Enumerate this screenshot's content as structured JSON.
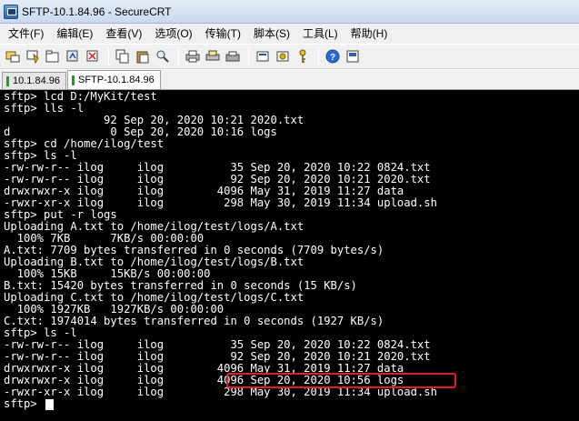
{
  "window": {
    "title": "SFTP-10.1.84.96 - SecureCRT"
  },
  "menu": {
    "items": [
      "文件(F)",
      "编辑(E)",
      "查看(V)",
      "选项(O)",
      "传输(T)",
      "脚本(S)",
      "工具(L)",
      "帮助(H)"
    ]
  },
  "toolbar": {
    "icons": [
      "connect-icon",
      "quick-connect-icon",
      "connect-tab-icon",
      "reconnect-icon",
      "disconnect-icon",
      "copy-icon",
      "paste-icon",
      "find-icon",
      "print-icon",
      "print-selection-icon",
      "print-setup-icon",
      "session-options-icon",
      "global-options-icon",
      "key-icon",
      "help-icon",
      "about-icon"
    ]
  },
  "tabs": [
    {
      "label": "10.1.84.96",
      "active": false
    },
    {
      "label": "SFTP-10.1.84.96",
      "active": true
    }
  ],
  "terminal": {
    "lines": [
      "sftp> lcd D:/MyKit/test",
      "sftp> lls -l",
      "               92 Sep 20, 2020 10:21 2020.txt",
      "d               0 Sep 20, 2020 10:16 logs",
      "sftp> cd /home/ilog/test",
      "sftp> ls -l",
      "-rw-rw-r-- ilog     ilog          35 Sep 20, 2020 10:22 0824.txt",
      "-rw-rw-r-- ilog     ilog          92 Sep 20, 2020 10:21 2020.txt",
      "drwxrwxr-x ilog     ilog        4096 May 31, 2019 11:27 data",
      "-rwxr-xr-x ilog     ilog         298 May 30, 2019 11:34 upload.sh",
      "sftp> put -r logs",
      "Uploading A.txt to /home/ilog/test/logs/A.txt",
      "  100% 7KB      7KB/s 00:00:00",
      "A.txt: 7709 bytes transferred in 0 seconds (7709 bytes/s)",
      "Uploading B.txt to /home/ilog/test/logs/B.txt",
      "  100% 15KB     15KB/s 00:00:00",
      "B.txt: 15420 bytes transferred in 0 seconds (15 KB/s)",
      "Uploading C.txt to /home/ilog/test/logs/C.txt",
      "  100% 1927KB   1927KB/s 00:00:00",
      "C.txt: 1974014 bytes transferred in 0 seconds (1927 KB/s)",
      "sftp> ls -l",
      "-rw-rw-r-- ilog     ilog          35 Sep 20, 2020 10:22 0824.txt",
      "-rw-rw-r-- ilog     ilog          92 Sep 20, 2020 10:21 2020.txt",
      "drwxrwxr-x ilog     ilog        4096 May 31, 2019 11:27 data",
      "drwxrwxr-x ilog     ilog        4096 Sep 20, 2020 10:56 logs",
      "-rwxr-xr-x ilog     ilog         298 May 30, 2019 11:34 upload.sh",
      "sftp> "
    ]
  }
}
